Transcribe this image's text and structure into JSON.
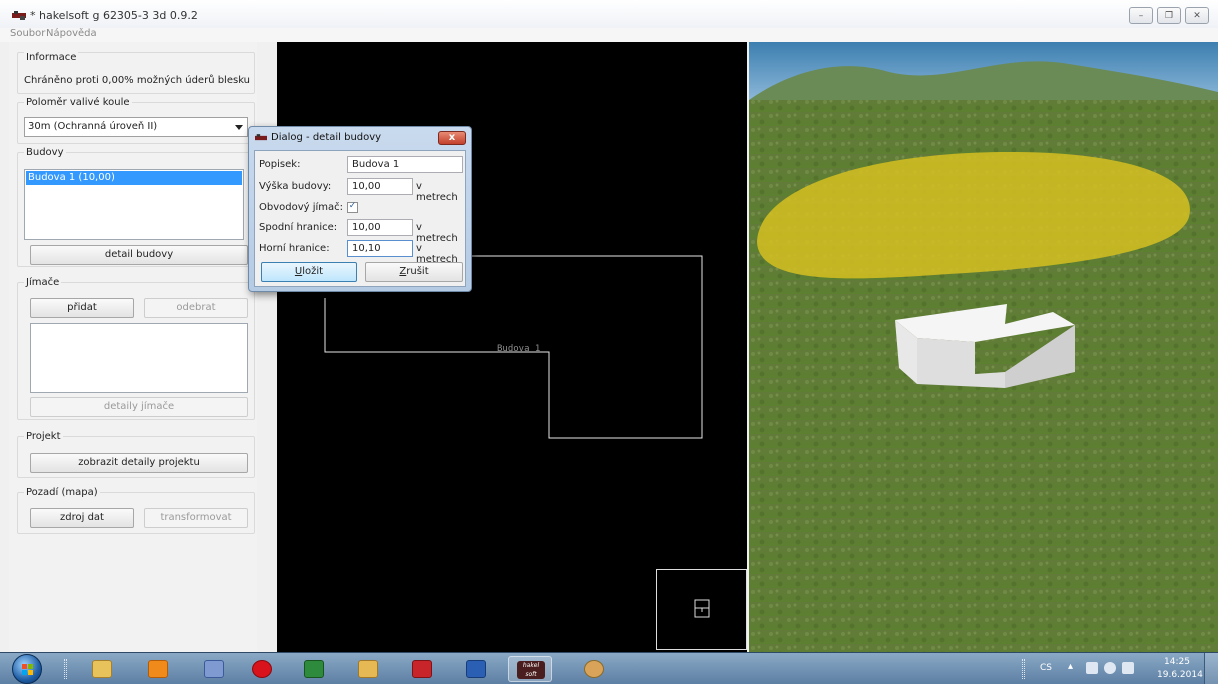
{
  "window": {
    "title": "* hakelsoft g 62305-3 3d 0.9.2",
    "minimize_glyph": "–",
    "maximize_glyph": "❐",
    "close_glyph": "✕"
  },
  "menu": {
    "items": [
      "Soubor",
      "Nápověda"
    ]
  },
  "left": {
    "info": {
      "title": "Informace",
      "text": "Chráněno proti 0,00% možných úderů blesku"
    },
    "radius": {
      "title": "Poloměr valivé koule",
      "selected": "30m (Ochranná úroveň II)"
    },
    "buildings": {
      "title": "Budovy",
      "items": [
        "Budova 1 (10,00)"
      ],
      "detail_button": "detail budovy"
    },
    "catchers": {
      "title": "Jímače",
      "add_button": "přidat",
      "remove_button": "odebrat",
      "details_button": "detaily jímače"
    },
    "project": {
      "title": "Projekt",
      "details_button": "zobrazit detaily projektu"
    },
    "background": {
      "title": "Pozadí (mapa)",
      "source_button": "zdroj dat",
      "transform_button": "transformovat"
    }
  },
  "view2d": {
    "building_label": "Budova 1"
  },
  "dialog": {
    "title": "Dialog - detail budovy",
    "close_glyph": "x",
    "fields": {
      "label_caption": "Popisek:",
      "label_value": "Budova 1",
      "height_caption": "Výška budovy:",
      "height_value": "10,00",
      "height_unit": "v metrech",
      "perimeter_caption": "Obvodový jímač:",
      "perimeter_checked": true,
      "check_glyph": "✓",
      "lower_caption": "Spodní hranice:",
      "lower_value": "10,00",
      "lower_unit": "v metrech",
      "upper_caption": "Horní hranice:",
      "upper_value": "10,10",
      "upper_unit": "v metrech"
    },
    "save_button_accel": "U",
    "save_button_rest": "ložit",
    "cancel_button_accel": "Z",
    "cancel_button_rest": "rušit"
  },
  "taskbar": {
    "apps": [
      "start-orb",
      "explorer",
      "media-player",
      "tool",
      "opera",
      "excel",
      "outlook",
      "acrobat",
      "word",
      "hakelsoft",
      "paint"
    ],
    "hakelsoft_label": "hakel soft",
    "tray": {
      "language": "CS",
      "time": "14:25",
      "date": "19.6.2014"
    }
  }
}
